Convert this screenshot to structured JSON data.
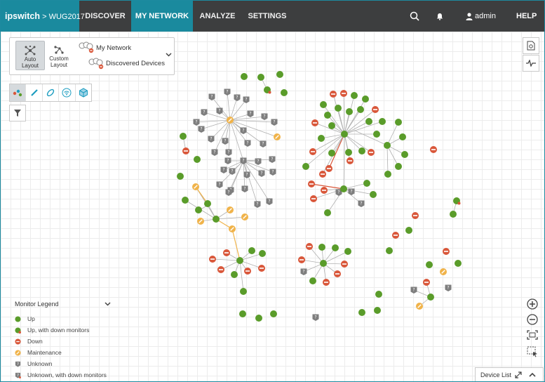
{
  "brand": {
    "name": "ipswitch",
    "product": "WUG2017"
  },
  "nav": {
    "items": [
      {
        "label": "DISCOVER"
      },
      {
        "label": "MY NETWORK"
      },
      {
        "label": "ANALYZE"
      },
      {
        "label": "SETTINGS"
      }
    ],
    "active": "MY NETWORK",
    "user": "admin",
    "help": "HELP"
  },
  "layout_panel": {
    "auto_label": "Auto Layout",
    "custom_label": "Custom Layout",
    "my_network": "My Network",
    "discovered_devices": "Discovered Devices"
  },
  "legend": {
    "title": "Monitor Legend",
    "items": [
      {
        "label": "Up",
        "status": "up"
      },
      {
        "label": "Up, with down monitors",
        "status": "up-down"
      },
      {
        "label": "Down",
        "status": "down"
      },
      {
        "label": "Maintenance",
        "status": "maint"
      },
      {
        "label": "Unknown",
        "status": "unknown"
      },
      {
        "label": "Unknown, with down monitors",
        "status": "unknown-down"
      }
    ]
  },
  "device_list": {
    "label": "Device List"
  },
  "colors": {
    "up": "#5a9c2a",
    "down": "#d9573a",
    "maintenance": "#f0b34a",
    "unknown": "#7e7e7e",
    "accent": "#1a8a9e",
    "topbar": "#3d3e3f"
  }
}
